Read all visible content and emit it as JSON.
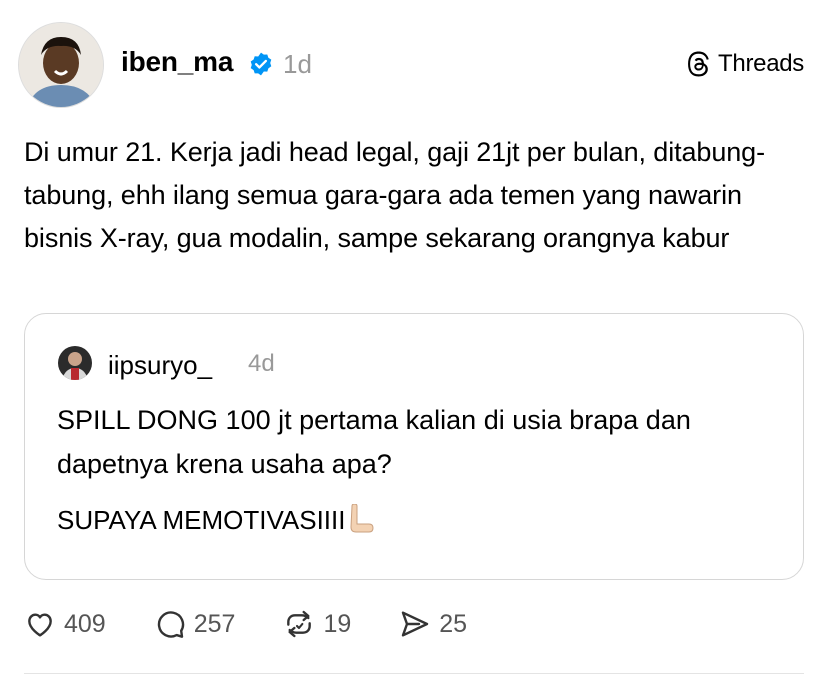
{
  "post": {
    "username": "iben_ma",
    "time": "1d",
    "text": "Di umur 21. Kerja jadi head legal, gaji 21jt per bulan, ditabung-tabung, ehh ilang semua gara-gara ada temen yang nawarin bisnis X-ray, gua modalin, sampe sekarang orangnya kabur"
  },
  "brand": {
    "label": "Threads"
  },
  "quote": {
    "username": "iipsuryo_",
    "time": "4d",
    "text": "SPILL DONG 100 jt pertama kalian di usia brapa dan dapetnya krena usaha apa?",
    "text2": "SUPAYA MEMOTIVASIIII"
  },
  "actions": {
    "likes": "409",
    "replies": "257",
    "reposts": "19",
    "shares": "25"
  },
  "icons": {
    "verified": "verified-badge-icon",
    "brand": "threads-logo-icon",
    "like": "heart-icon",
    "reply": "comment-icon",
    "repost": "repost-icon",
    "share": "send-icon"
  },
  "colors": {
    "verified": "#0095f6",
    "muted": "#999999",
    "border": "#d6d6d6"
  }
}
